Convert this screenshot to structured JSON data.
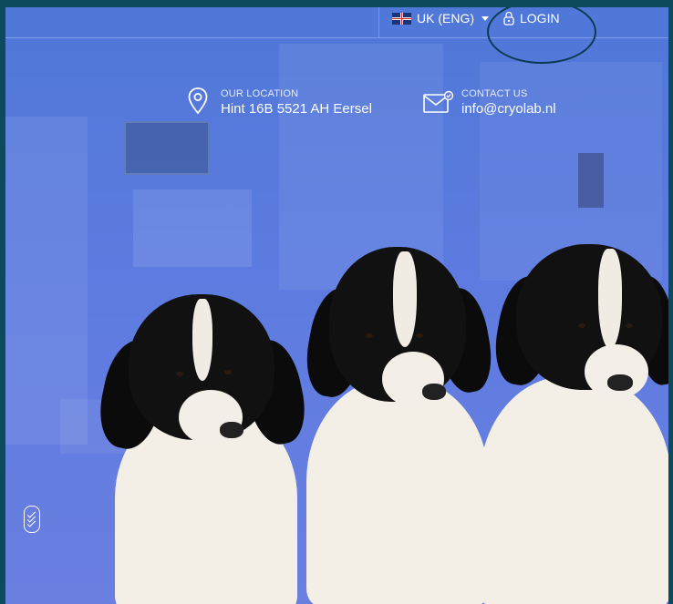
{
  "topbar": {
    "language": "UK (ENG)",
    "login": "LOGIN"
  },
  "contact": {
    "location_label": "OUR LOCATION",
    "location_value": "Hint 16B 5521 AH Eersel",
    "contact_label": "CONTACT US",
    "contact_value": "info@cryolab.nl"
  },
  "colors": {
    "frame": "#0c4a5c",
    "overlay": "#5d7be0",
    "highlight_ellipse": "#0d3a52"
  },
  "icons": [
    "uk-flag-icon",
    "chevron-down-icon",
    "lock-icon",
    "map-pin-icon",
    "mail-icon",
    "scroll-down-icon"
  ]
}
